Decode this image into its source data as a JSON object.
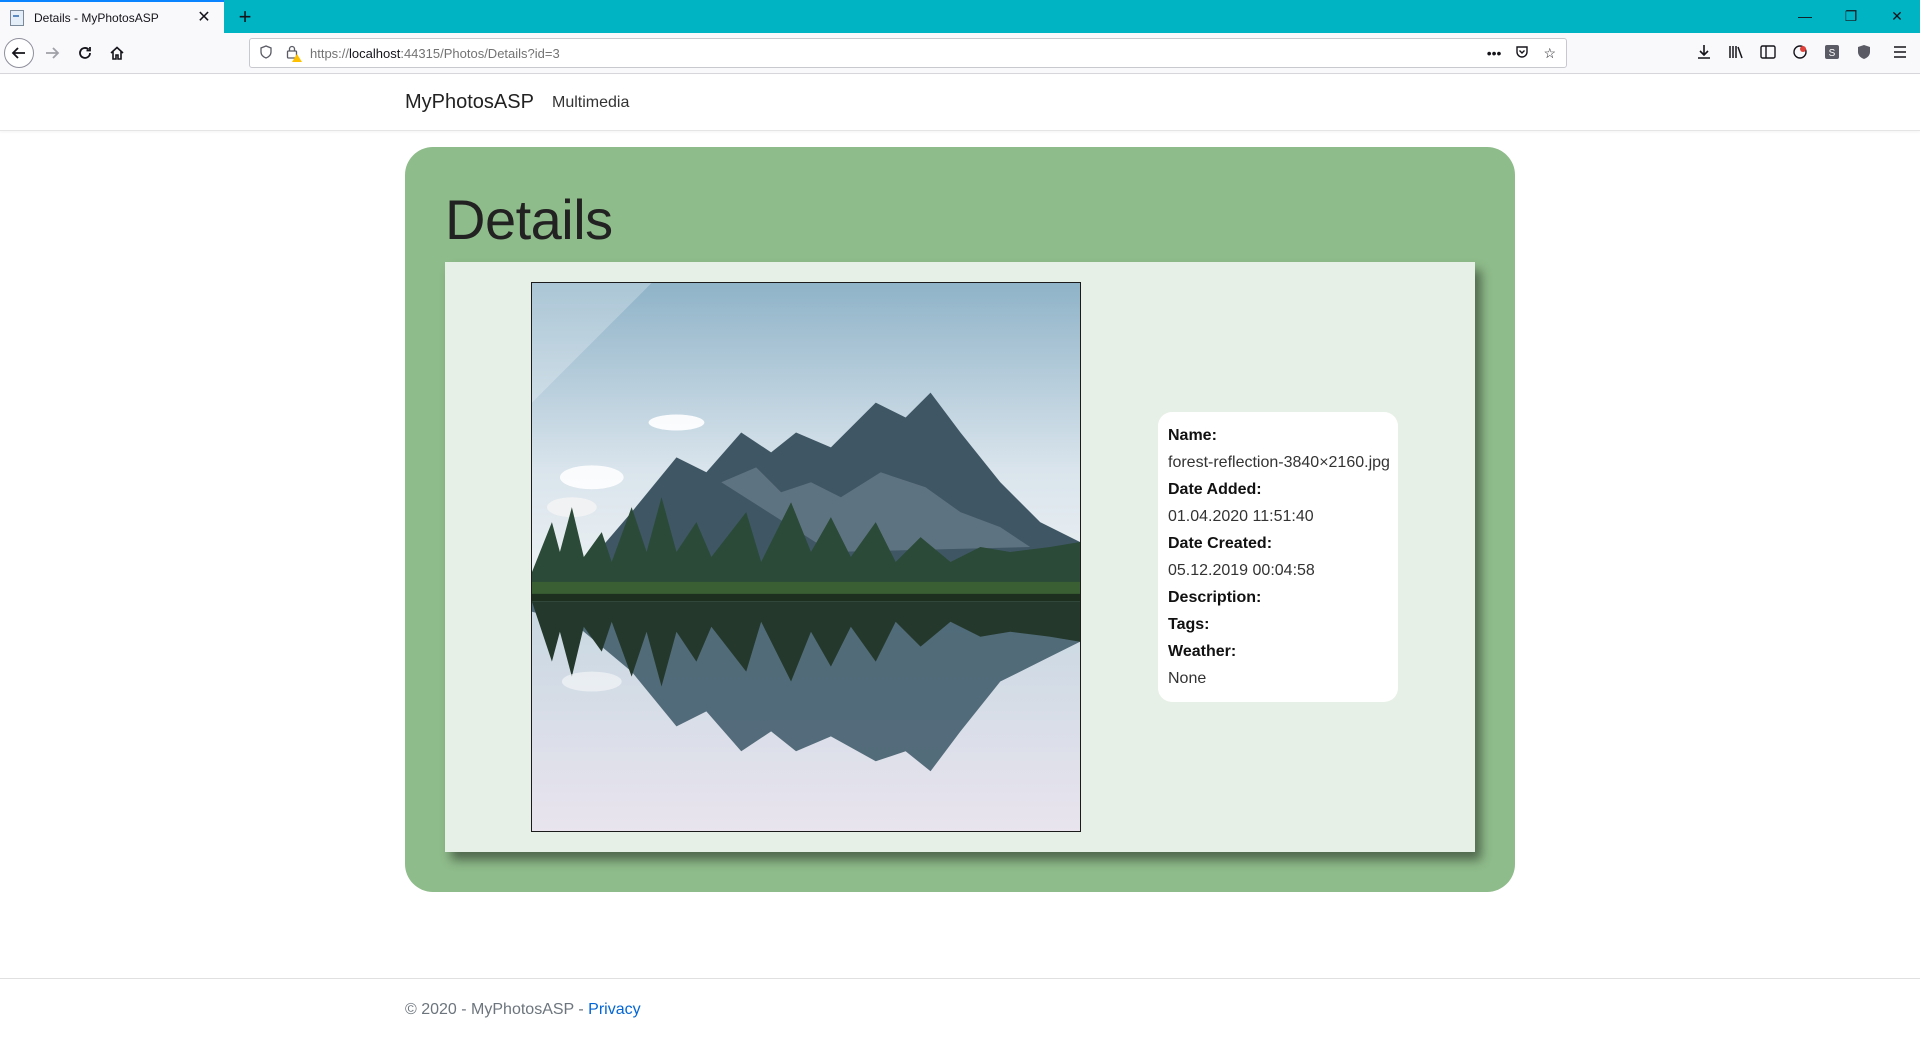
{
  "browser": {
    "tab_title": "Details - MyPhotosASP",
    "tab_close": "✕",
    "new_tab": "+",
    "url_scheme": "https://",
    "url_host": "localhost",
    "url_rest": ":44315/Photos/Details?id=3",
    "window_controls": {
      "minimize": "—",
      "restore": "❐",
      "close": "✕"
    },
    "icons": [
      "back-icon",
      "forward-icon",
      "reload-icon",
      "home-icon",
      "shield-icon",
      "lock-warning-icon",
      "more-icon",
      "pocket-icon",
      "bookmark-star-icon",
      "download-icon",
      "library-icon",
      "sidebar-icon",
      "extension-icon",
      "extension-icon",
      "ublock-icon",
      "menu-icon"
    ]
  },
  "site": {
    "brand": "MyPhotosASP",
    "nav": {
      "multimedia": "Multimedia"
    }
  },
  "details": {
    "heading": "Details",
    "fields": {
      "name_label": "Name:",
      "name_value": "forest-reflection-3840×2160.jpg",
      "date_added_label": "Date Added:",
      "date_added_value": "01.04.2020 11:51:40",
      "date_created_label": "Date Created:",
      "date_created_value": "05.12.2019 00:04:58",
      "description_label": "Description:",
      "tags_label": "Tags:",
      "weather_label": "Weather:",
      "weather_value": "None"
    }
  },
  "footer": {
    "copyright": "© 2020 - MyPhotosASP - ",
    "privacy_link": "Privacy"
  },
  "colors": {
    "tab_strip": "#00b4c4",
    "card_bg": "#8fbc8b",
    "panel_bg": "#e7f0e6",
    "link": "#0366d6"
  }
}
